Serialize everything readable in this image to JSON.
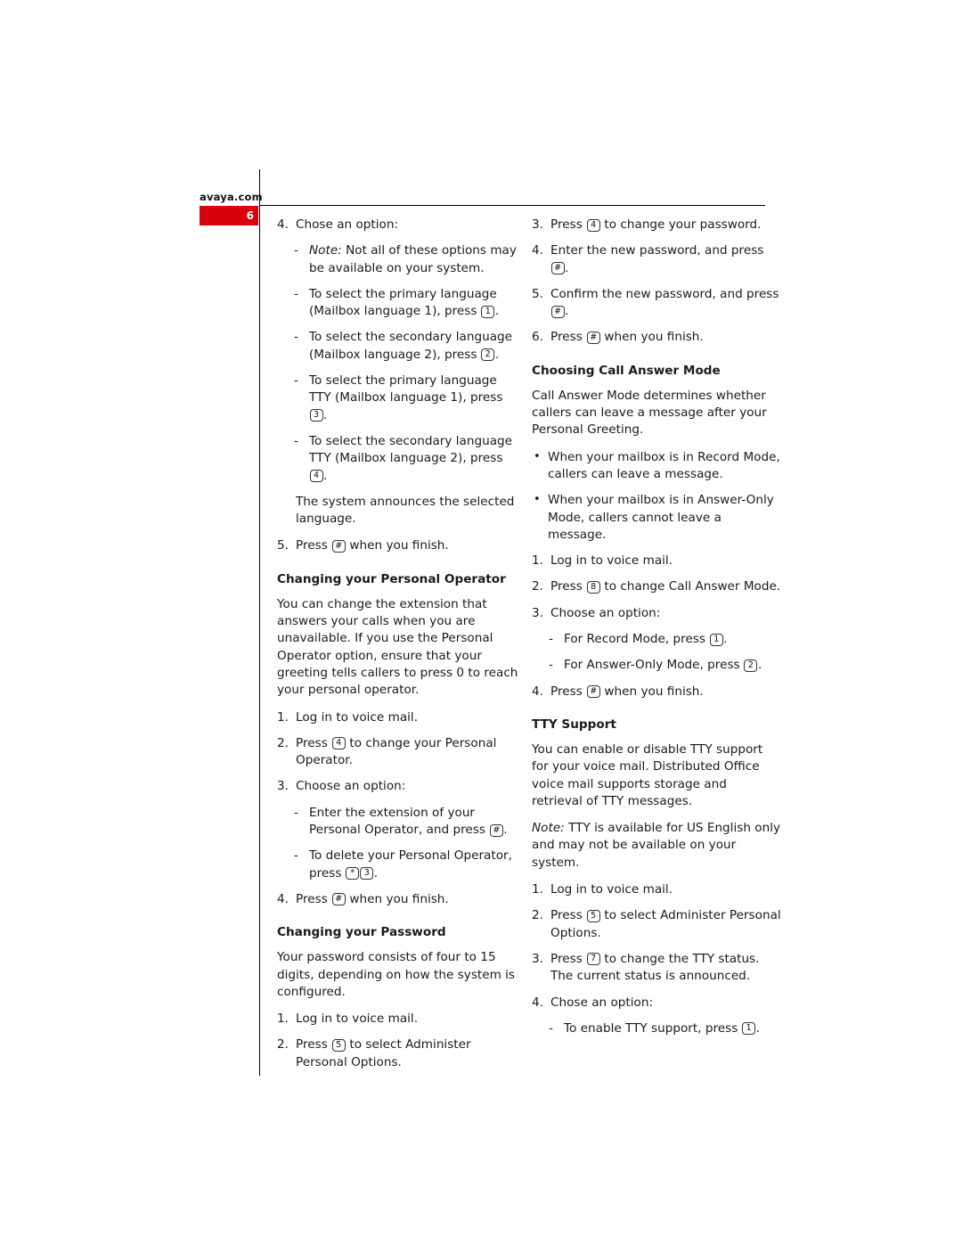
{
  "brand": "avaya.com",
  "page_number": "6",
  "left_column": {
    "items": [
      {
        "type": "num",
        "n": "4.",
        "text": "Chose an option:"
      },
      {
        "type": "dash",
        "pre_italic": "Note:",
        "text": " Not all of these options may be available on your system."
      },
      {
        "type": "dash",
        "text": "To select the primary language (Mailbox language 1), press ",
        "key": "1",
        "after": "."
      },
      {
        "type": "dash",
        "text": "To select the secondary language (Mailbox language 2), press ",
        "key": "2",
        "after": "."
      },
      {
        "type": "dash",
        "text": "To select the primary language TTY (Mailbox language 1), press ",
        "key": "3",
        "after": "."
      },
      {
        "type": "dash",
        "text": "To select the secondary language TTY (Mailbox language 2), press ",
        "key": "4",
        "after": "."
      },
      {
        "type": "plain",
        "text": "The system announces the selected language."
      },
      {
        "type": "num",
        "n": "5.",
        "text": "Press ",
        "key": "#",
        "after": " when you finish."
      }
    ],
    "section_operator": {
      "heading": "Changing your Personal Operator",
      "body": "You can change the extension that answers your calls when you are unavailable. If you use the Personal Operator option, ensure that your greeting tells callers to press 0 to reach your personal operator.",
      "items": [
        {
          "type": "num",
          "n": "1.",
          "text": "Log in to voice mail."
        },
        {
          "type": "num",
          "n": "2.",
          "text": "Press ",
          "key": "4",
          "after": " to change your Personal Operator."
        },
        {
          "type": "num",
          "n": "3.",
          "text": "Choose an option:"
        },
        {
          "type": "dash",
          "text": "Enter the extension of your Personal Operator, and press ",
          "key": "#",
          "after": "."
        },
        {
          "type": "dash",
          "text": "To delete your Personal Operator, press ",
          "key": "*",
          "key2": "3",
          "after": "."
        },
        {
          "type": "num",
          "n": "4.",
          "text": "Press ",
          "key": "#",
          "after": " when you finish."
        }
      ]
    },
    "section_password": {
      "heading": "Changing your Password",
      "body": "Your password consists of four to 15 digits, depending on how the system is configured.",
      "items": [
        {
          "type": "num",
          "n": "1.",
          "text": "Log in to voice mail."
        },
        {
          "type": "num",
          "n": "2.",
          "text": "Press ",
          "key": "5",
          "after": " to select Administer Personal Options."
        }
      ]
    }
  },
  "right_column": {
    "items_top": [
      {
        "type": "num",
        "n": "3.",
        "text": "Press ",
        "key": "4",
        "after": " to change your password."
      },
      {
        "type": "num",
        "n": "4.",
        "text": "Enter the new password, and press ",
        "key": "#",
        "after": "."
      },
      {
        "type": "num",
        "n": "5.",
        "text": "Confirm the new password, and press ",
        "key": "#",
        "after": "."
      },
      {
        "type": "num",
        "n": "6.",
        "text": "Press ",
        "key": "#",
        "after": " when you finish."
      }
    ],
    "section_call_answer": {
      "heading": "Choosing Call Answer Mode",
      "body": "Call Answer Mode determines whether callers can leave a message after your Personal Greeting.",
      "bullets": [
        "When your mailbox is in Record Mode, callers can leave a message.",
        "When your mailbox is in Answer-Only Mode, callers cannot leave a message."
      ],
      "items": [
        {
          "type": "num",
          "n": "1.",
          "text": "Log in to voice mail."
        },
        {
          "type": "num",
          "n": "2.",
          "text": "Press ",
          "key": "8",
          "after": " to change Call Answer Mode."
        },
        {
          "type": "num",
          "n": "3.",
          "text": "Choose an option:"
        },
        {
          "type": "dash",
          "text": "For Record Mode, press ",
          "key": "1",
          "after": "."
        },
        {
          "type": "dash",
          "text": "For Answer-Only Mode, press ",
          "key": "2",
          "after": "."
        },
        {
          "type": "num",
          "n": "4.",
          "text": "Press ",
          "key": "#",
          "after": " when you finish."
        }
      ]
    },
    "section_tty": {
      "heading": "TTY Support",
      "body": "You can enable or disable TTY support for your voice mail. Distributed Office voice mail supports storage and retrieval of TTY messages.",
      "note_label": "Note:",
      "note": " TTY is available for US English only and may not be available on your system.",
      "items": [
        {
          "type": "num",
          "n": "1.",
          "text": "Log in to voice mail."
        },
        {
          "type": "num",
          "n": "2.",
          "text": "Press ",
          "key": "5",
          "after": " to select Administer Personal Options."
        },
        {
          "type": "num",
          "n": "3.",
          "text": "Press ",
          "key": "7",
          "after": " to change the TTY status. The current status is announced."
        },
        {
          "type": "num",
          "n": "4.",
          "text": "Chose an option:"
        },
        {
          "type": "dash",
          "text": "To enable TTY support, press ",
          "key": "1",
          "after": "."
        }
      ]
    }
  }
}
